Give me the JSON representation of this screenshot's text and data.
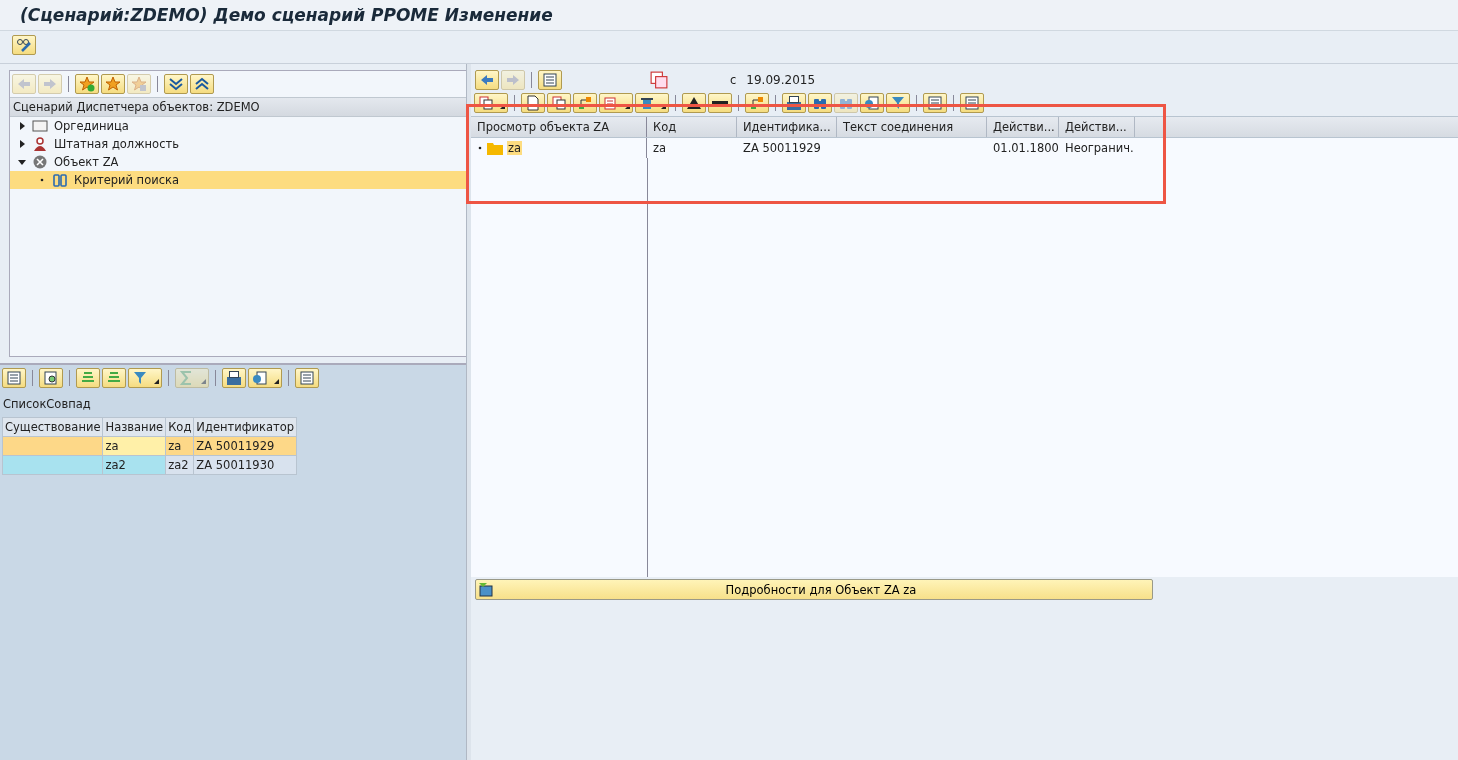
{
  "window": {
    "title": "(Сценарий:ZDEMO) Демо сценарий PPOME Изменение"
  },
  "app_toolbar": [
    {
      "kind": "glasses-pen",
      "disabled": false
    }
  ],
  "left_toolbar": [
    {
      "kind": "back",
      "disabled": true
    },
    {
      "kind": "forward",
      "disabled": true
    },
    {
      "kind": "sep"
    },
    {
      "kind": "star-add",
      "disabled": false
    },
    {
      "kind": "star",
      "disabled": false
    },
    {
      "kind": "star-delete",
      "disabled": true
    },
    {
      "kind": "sep"
    },
    {
      "kind": "expand",
      "disabled": false
    },
    {
      "kind": "collapse",
      "disabled": false
    }
  ],
  "tree": {
    "title": "Сценарий Диспетчера объектов: ZDEMO",
    "items": [
      {
        "label": "Оргединица",
        "kind": "org-unit",
        "expanded": false,
        "selected": false
      },
      {
        "label": "Штатная должность",
        "kind": "position",
        "expanded": false,
        "selected": false
      },
      {
        "label": "Объект ZA",
        "kind": "object",
        "expanded": true,
        "selected": false,
        "children": [
          {
            "label": "Критерий поиска",
            "kind": "search",
            "selected": true
          }
        ]
      }
    ]
  },
  "list_toolbar": [
    {
      "kind": "details",
      "disabled": false
    },
    {
      "kind": "sep"
    },
    {
      "kind": "find",
      "disabled": false
    },
    {
      "kind": "sep"
    },
    {
      "kind": "sort-asc",
      "disabled": false
    },
    {
      "kind": "sort-desc",
      "disabled": false
    },
    {
      "kind": "filter",
      "disabled": false,
      "menu": true
    },
    {
      "kind": "sep"
    },
    {
      "kind": "sum",
      "disabled": true,
      "menu": true
    },
    {
      "kind": "sep"
    },
    {
      "kind": "print",
      "disabled": false
    },
    {
      "kind": "export",
      "disabled": false,
      "menu": true
    },
    {
      "kind": "sep"
    },
    {
      "kind": "layout",
      "disabled": false
    }
  ],
  "hit_list": {
    "title": "СписокСовпад",
    "columns": [
      "Существование",
      "Название",
      "Код",
      "Идентификатор"
    ],
    "rows": [
      {
        "cells": [
          "",
          "za",
          "za",
          "ZA 50011929"
        ],
        "selected": true
      },
      {
        "cells": [
          "",
          "za2",
          "za2",
          "ZA 50011930"
        ],
        "selected": false
      }
    ]
  },
  "right_nav": [
    {
      "kind": "back",
      "disabled": false
    },
    {
      "kind": "forward",
      "disabled": true
    },
    {
      "kind": "sep"
    },
    {
      "kind": "details",
      "disabled": false
    }
  ],
  "period": {
    "label": "с",
    "date": "19.09.2015"
  },
  "object_toolbar": [
    {
      "kind": "copy",
      "disabled": false,
      "menu": true
    },
    {
      "kind": "sep"
    },
    {
      "kind": "new",
      "disabled": false
    },
    {
      "kind": "copy",
      "disabled": false
    },
    {
      "kind": "relate",
      "disabled": false
    },
    {
      "kind": "edit",
      "disabled": false,
      "menu": true
    },
    {
      "kind": "delete",
      "disabled": false,
      "menu": true
    },
    {
      "kind": "sep"
    },
    {
      "kind": "up",
      "disabled": false
    },
    {
      "kind": "down",
      "disabled": false
    },
    {
      "kind": "sep"
    },
    {
      "kind": "relate",
      "disabled": false
    },
    {
      "kind": "sep"
    },
    {
      "kind": "print",
      "disabled": false
    },
    {
      "kind": "binoculars",
      "disabled": false
    },
    {
      "kind": "binoculars",
      "disabled": true
    },
    {
      "kind": "export",
      "disabled": false
    },
    {
      "kind": "filter",
      "disabled": false
    },
    {
      "kind": "sep"
    },
    {
      "kind": "layout",
      "disabled": false
    },
    {
      "kind": "sep"
    },
    {
      "kind": "details",
      "disabled": false
    }
  ],
  "object_view": {
    "columns": [
      "Просмотр объекта ZA",
      "Код",
      "Идентифика...",
      "Текст соединения",
      "Действи...",
      "Действи..."
    ],
    "rows": [
      {
        "cells": [
          "za",
          "za",
          "ZA 50011929",
          "",
          "01.01.1800",
          "Неогранич."
        ],
        "selected": true
      }
    ]
  },
  "details_bar": {
    "label": "Подробности для Объект ZA za"
  }
}
